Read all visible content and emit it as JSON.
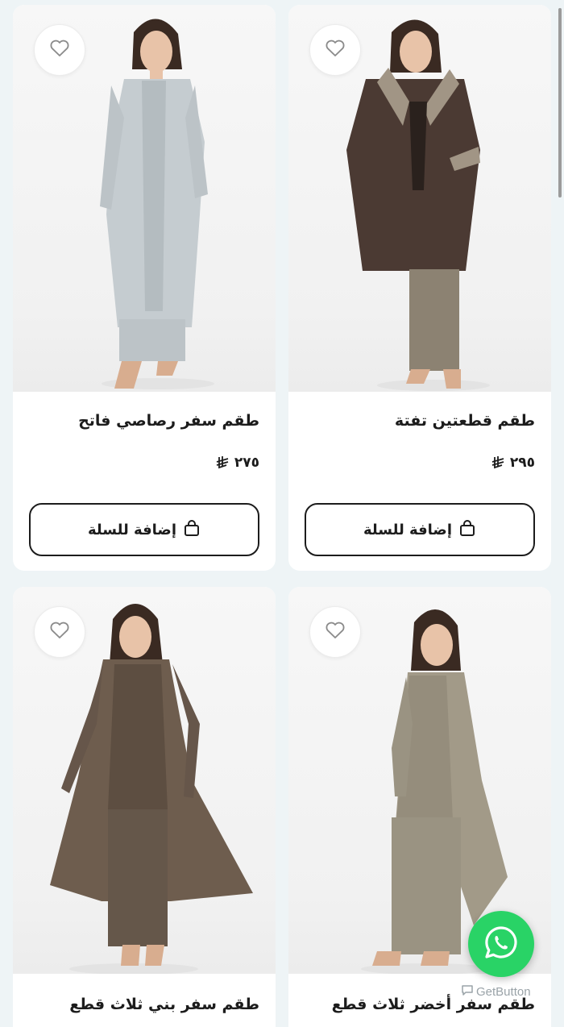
{
  "products": [
    {
      "title": "طقم سفر رصاصي فاتح",
      "price": "٢٧٥",
      "add_label": "إضافة للسلة",
      "garment_color": "#c5ccd0",
      "pants_color": "#bcc3c7"
    },
    {
      "title": "طقم قطعتين تفتة",
      "price": "٢٩٥",
      "add_label": "إضافة للسلة",
      "garment_color": "#4b3a33",
      "pants_color": "#8c8272"
    },
    {
      "title": "طقم سفر بني ثلاث قطع",
      "garment_color": "#6e5d4e",
      "pants_color": "#65574a"
    },
    {
      "title": "طقم سفر أخضر ثلاث قطع",
      "garment_color": "#a29a88",
      "pants_color": "#9a9382"
    }
  ],
  "icons": {
    "favorite": "heart-icon",
    "cart": "shopping-bag-icon",
    "currency": "riyal-symbol-icon",
    "chat": "whatsapp-icon"
  },
  "widget": {
    "brand": "GetButton"
  },
  "colors": {
    "background": "#eef4f6",
    "card": "#ffffff",
    "text": "#1c1c1c",
    "whatsapp": "#29d366"
  }
}
